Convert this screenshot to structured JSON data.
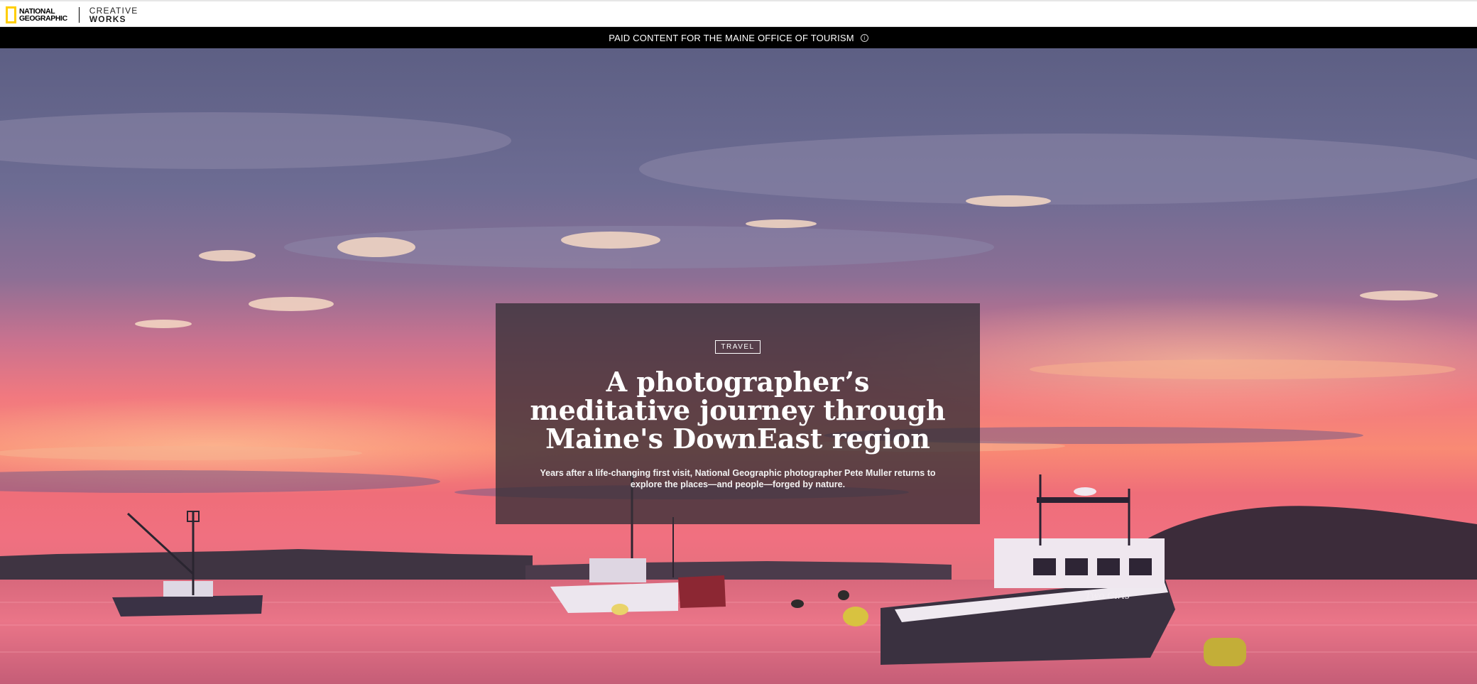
{
  "header": {
    "brand_line1": "NATIONAL",
    "brand_line2": "GEOGRAPHIC",
    "sub_brand_line1": "CREATIVE",
    "sub_brand_line2": "WORKS",
    "logo_accent_color": "#FFCE00"
  },
  "sponsor": {
    "text": "PAID CONTENT FOR THE MAINE OFFICE OF TOURISM",
    "icon": "info-icon"
  },
  "hero": {
    "category": "TRAVEL",
    "title": "A photographer’s meditative journey through Maine's DownEast region",
    "dek": "Years after a life-changing first visit, National Geographic photographer Pete Muller returns to explore the places—and people—forged by nature.",
    "boat_name": "Two Girls"
  }
}
